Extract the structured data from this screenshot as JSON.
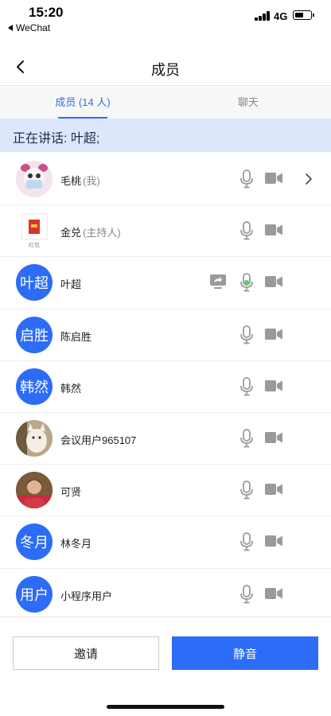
{
  "status_bar": {
    "time": "15:20",
    "back_app": "WeChat",
    "network": "4G"
  },
  "header": {
    "title": "成员"
  },
  "tabs": [
    {
      "label": "成员 (14 人)",
      "active": true
    },
    {
      "label": "聊天",
      "active": false
    }
  ],
  "speaking": {
    "text": "正在讲话: 叶超;"
  },
  "members": [
    {
      "name": "毛桃",
      "role": "(我)",
      "avatar_text": "",
      "avatar_type": "photo-doll",
      "has_chevron": true,
      "sharing": false,
      "speaking": false
    },
    {
      "name": "金兑",
      "role": "(主持人)",
      "avatar_text": "红包",
      "avatar_type": "redpacket",
      "has_chevron": false,
      "sharing": false,
      "speaking": false
    },
    {
      "name": "叶超",
      "role": "",
      "avatar_text": "叶超",
      "avatar_type": "text",
      "has_chevron": false,
      "sharing": true,
      "speaking": true
    },
    {
      "name": "陈启胜",
      "role": "",
      "avatar_text": "启胜",
      "avatar_type": "text",
      "has_chevron": false,
      "sharing": false,
      "speaking": false
    },
    {
      "name": "韩然",
      "role": "",
      "avatar_text": "韩然",
      "avatar_type": "text",
      "has_chevron": false,
      "sharing": false,
      "speaking": false
    },
    {
      "name": "会议用户965107",
      "role": "",
      "avatar_text": "",
      "avatar_type": "photo-cat",
      "has_chevron": false,
      "sharing": false,
      "speaking": false
    },
    {
      "name": "可贤",
      "role": "",
      "avatar_text": "",
      "avatar_type": "photo-person",
      "has_chevron": false,
      "sharing": false,
      "speaking": false
    },
    {
      "name": "林冬月",
      "role": "",
      "avatar_text": "冬月",
      "avatar_type": "text",
      "has_chevron": false,
      "sharing": false,
      "speaking": false
    },
    {
      "name": "小程序用户",
      "role": "",
      "avatar_text": "用户",
      "avatar_type": "text",
      "has_chevron": false,
      "sharing": false,
      "speaking": false
    }
  ],
  "actions": {
    "invite_label": "邀请",
    "mute_label": "静音"
  },
  "colors": {
    "accent": "#2c6cf6",
    "banner_bg": "#dce7fb",
    "speaking_green": "#4cd964",
    "icon_gray": "#9a9a9a"
  },
  "icons": [
    "back-arrow-icon",
    "microphone-icon",
    "camera-icon",
    "chevron-right-icon",
    "screen-share-icon"
  ]
}
